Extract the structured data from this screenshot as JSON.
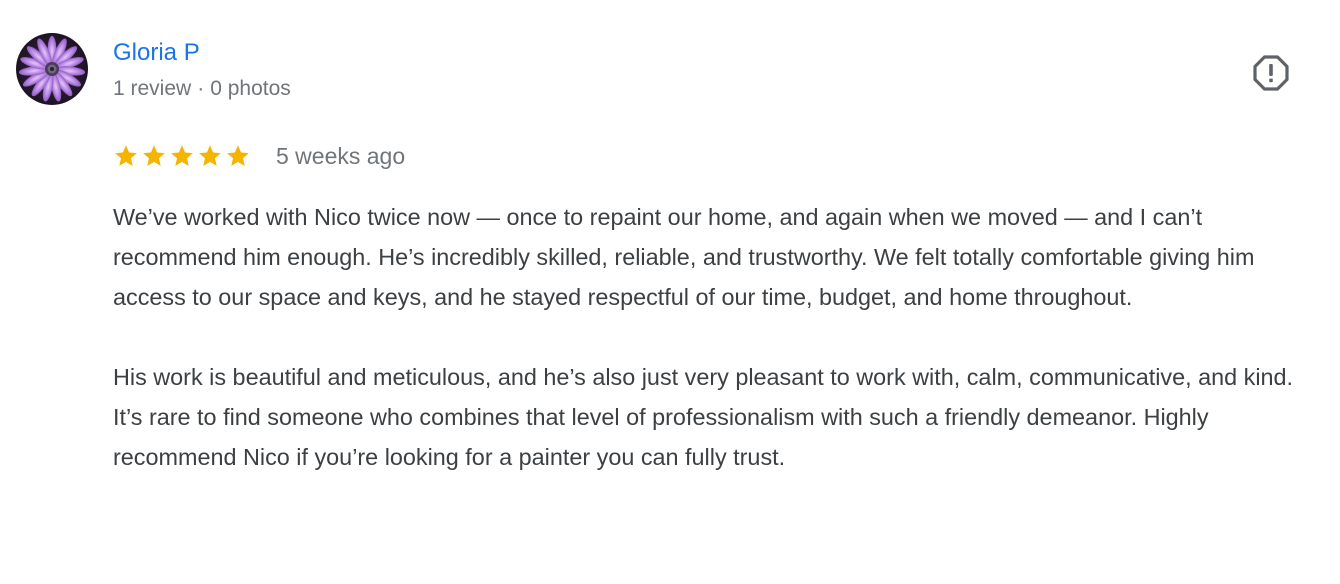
{
  "reviewer": {
    "name": "Gloria P",
    "review_count": "1 review",
    "separator": "·",
    "photo_count": "0 photos",
    "avatar": "purple-flower-photo"
  },
  "actions": {
    "report_icon": "report-octagon-icon"
  },
  "rating": {
    "stars": 5,
    "max_stars": 5,
    "star_color": "#f4b400",
    "time_ago": "5 weeks ago"
  },
  "review": {
    "paragraphs": [
      "We’ve worked with Nico twice now — once to repaint our home, and again when we moved — and I can’t recommend him enough. He’s incredibly skilled, reliable, and trustworthy. We felt totally comfortable giving him access to our space and keys, and he stayed respectful of our time, budget, and home throughout.",
      "His work is beautiful and meticulous, and he’s also just very pleasant to work with, calm, communicative, and kind. It’s rare to find someone who combines that level of professionalism with such a friendly demeanor. Highly recommend Nico if you’re looking for a painter you can fully trust."
    ]
  },
  "colors": {
    "name_link": "#1a73e8",
    "secondary_text": "#70757a",
    "body_text": "#3c4043",
    "icon": "#5f6368"
  }
}
